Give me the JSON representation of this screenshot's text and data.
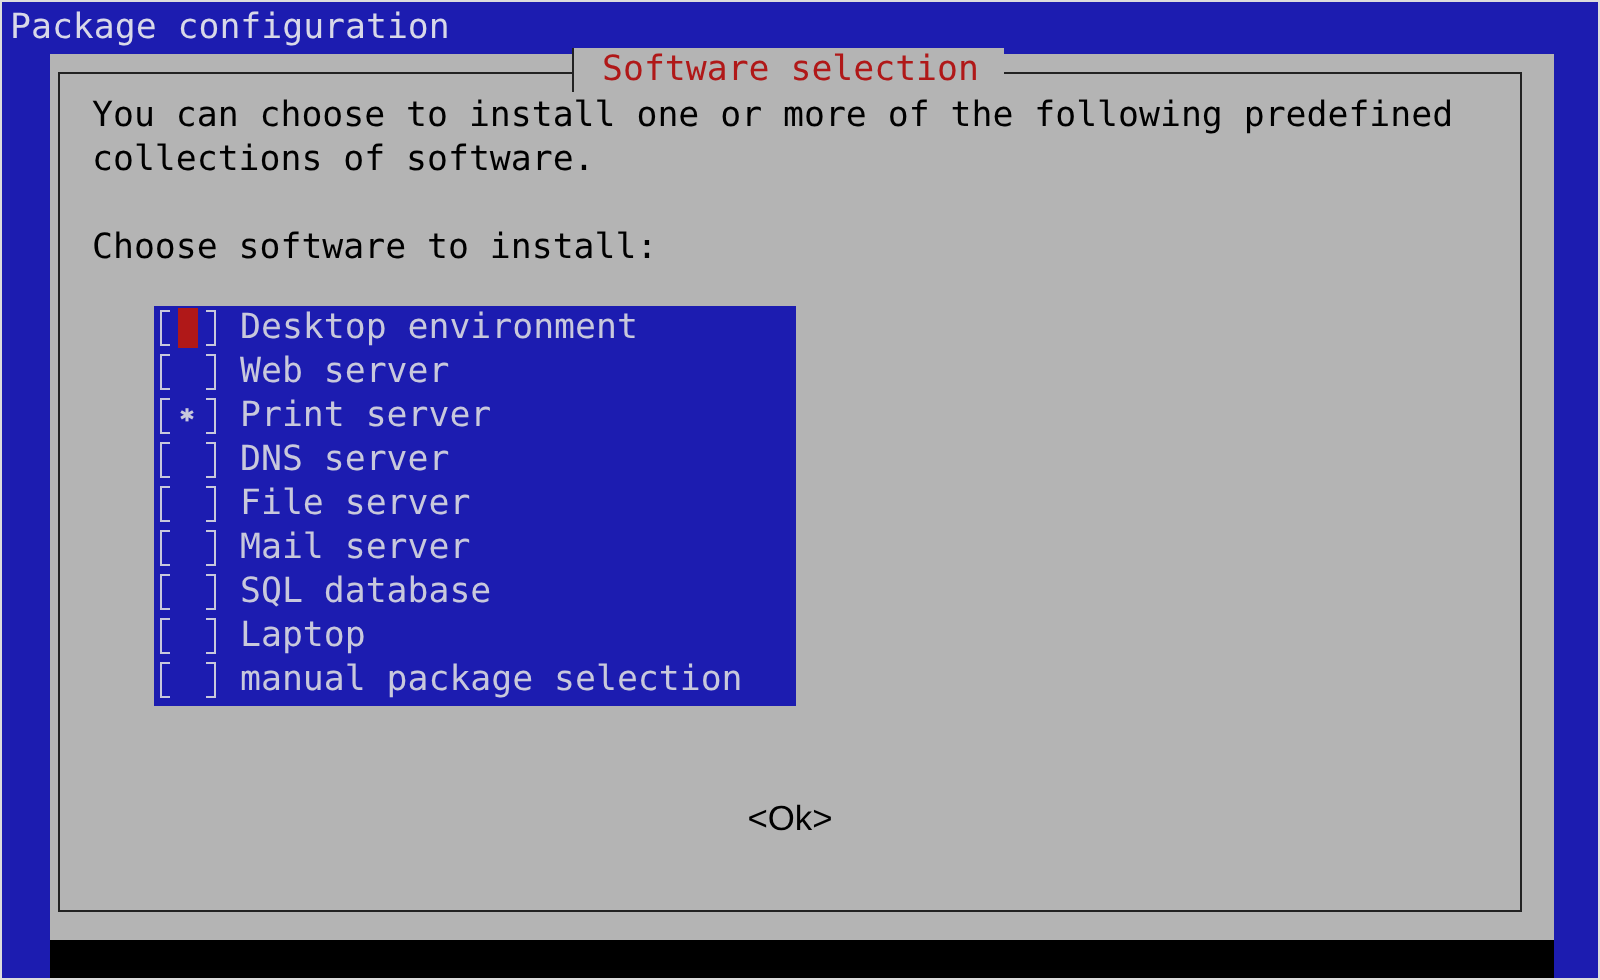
{
  "window": {
    "title": "Package configuration"
  },
  "dialog": {
    "title": "Software selection",
    "intro": "You can choose to install one or more of the following predefined collections of software.",
    "prompt": "Choose software to install:",
    "items": [
      {
        "label": "Desktop environment",
        "checked": false,
        "selected": true
      },
      {
        "label": "Web server",
        "checked": false,
        "selected": false
      },
      {
        "label": "Print server",
        "checked": true,
        "selected": false
      },
      {
        "label": "DNS server",
        "checked": false,
        "selected": false
      },
      {
        "label": "File server",
        "checked": false,
        "selected": false
      },
      {
        "label": "Mail server",
        "checked": false,
        "selected": false
      },
      {
        "label": "SQL database",
        "checked": false,
        "selected": false
      },
      {
        "label": "Laptop",
        "checked": false,
        "selected": false
      },
      {
        "label": "manual package selection",
        "checked": false,
        "selected": false
      }
    ],
    "buttons": [
      "<Ok>"
    ]
  }
}
